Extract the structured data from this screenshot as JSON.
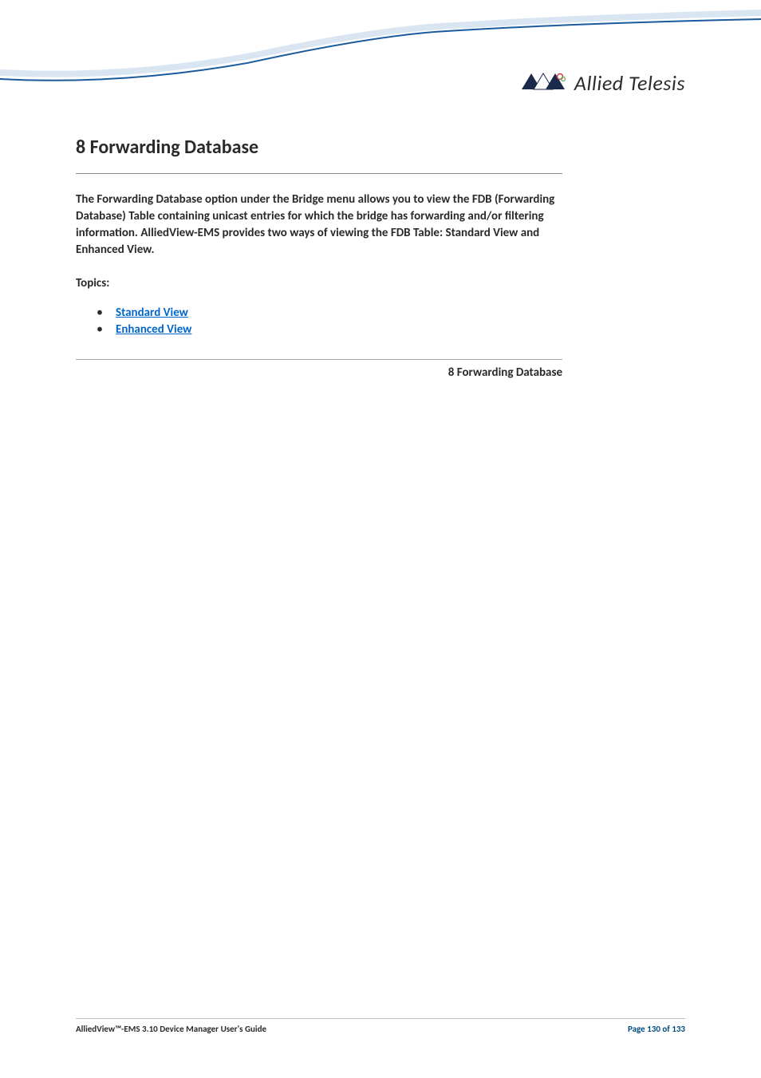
{
  "brand": {
    "name": "Allied Telesis"
  },
  "section": {
    "title": "8 Forwarding Database",
    "intro": "The Forwarding Database option under the Bridge menu allows you to view the FDB (Forwarding Database) Table containing unicast entries for which the bridge has forwarding and/or filtering information. AlliedView-EMS provides two ways of viewing the FDB Table: Standard View and Enhanced View.",
    "topics_label": "Topics:",
    "topics": [
      {
        "label": "Standard View"
      },
      {
        "label": "Enhanced View"
      }
    ],
    "breadcrumb": "8 Forwarding Database"
  },
  "footer": {
    "guide_name": "AlliedView™-EMS 3.10 Device Manager User's Guide",
    "page_info": "Page 130 of 133"
  }
}
